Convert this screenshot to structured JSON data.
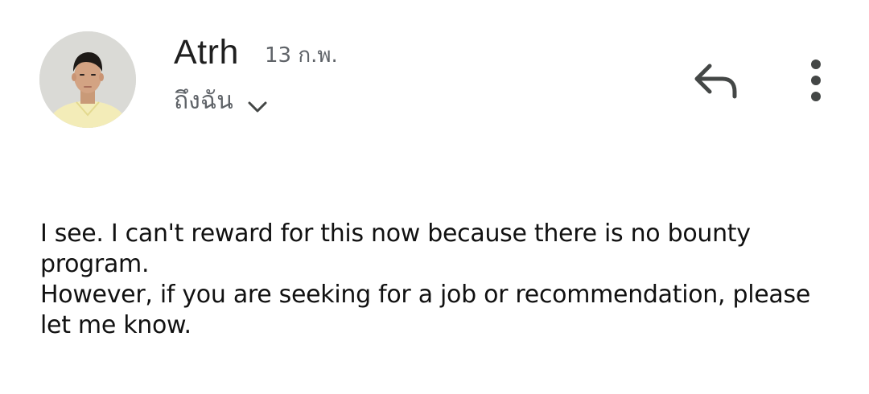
{
  "message": {
    "sender_name": "Atrh",
    "date": "13 ก.พ.",
    "recipient_label": "ถึงฉัน",
    "body_lines": [
      "I see. I can't reward for this now because there is no bounty program.",
      "However, if you are seeking for a job or recommendation, please let me know."
    ]
  },
  "icons": {
    "reply": "reply-icon",
    "more": "more-vert-icon",
    "expand": "chevron-down-icon"
  },
  "colors": {
    "background": "#ffffff",
    "primary_text": "#1f1f1f",
    "secondary_text": "#5f6368",
    "icon": "#444746",
    "avatar_shirt": "#f3ecb8"
  }
}
